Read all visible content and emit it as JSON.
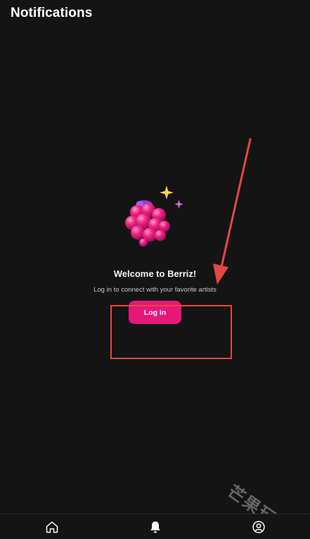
{
  "header": {
    "title": "Notifications"
  },
  "empty_state": {
    "illustration": "raspberry-sparkle",
    "title": "Welcome to Berriz!",
    "subtitle": "Log in to connect with your favorite artists",
    "login_label": "Log in"
  },
  "tabbar": {
    "items": [
      {
        "icon": "home-icon",
        "active": false
      },
      {
        "icon": "bell-icon",
        "active": true
      },
      {
        "icon": "profile-icon",
        "active": false
      }
    ]
  },
  "watermark": {
    "text": "芒果玩"
  },
  "colors": {
    "background": "#141414",
    "accent": "#e6177a",
    "annotation": "#e84545"
  }
}
